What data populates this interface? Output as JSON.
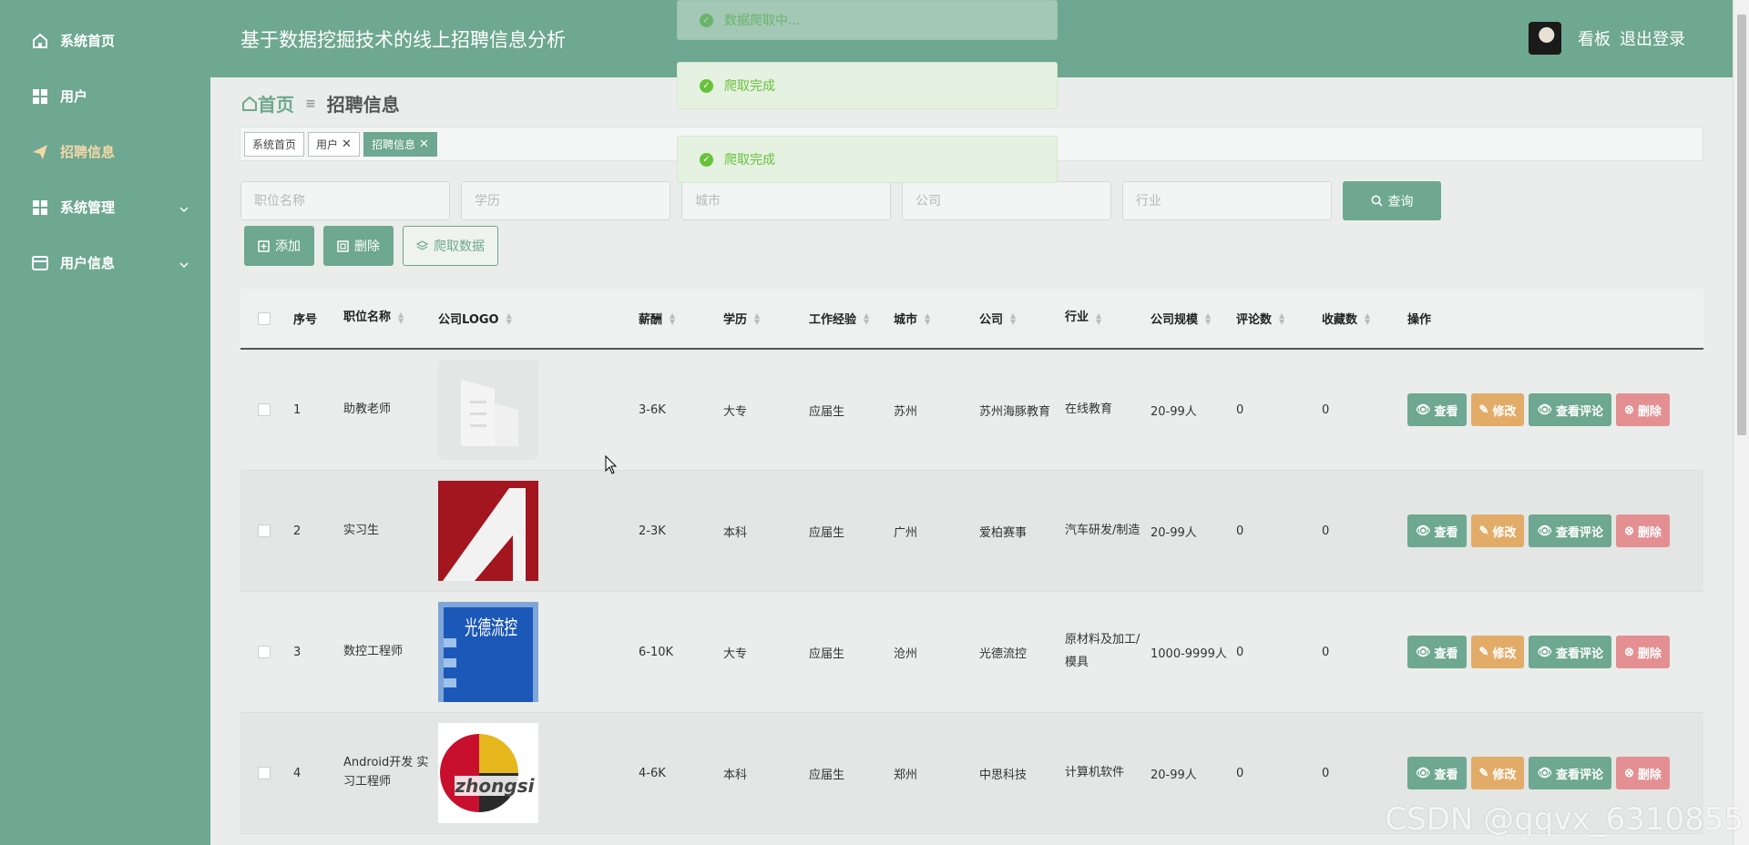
{
  "sidebar": {
    "items": [
      {
        "label": "系统首页",
        "icon": "home-icon"
      },
      {
        "label": "用户",
        "icon": "grid-icon"
      },
      {
        "label": "招聘信息",
        "icon": "paper-plane-icon"
      },
      {
        "label": "系统管理",
        "icon": "grid-icon"
      },
      {
        "label": "用户信息",
        "icon": "card-icon"
      }
    ]
  },
  "header": {
    "title": "基于数据挖掘技术的线上招聘信息分析",
    "board": "看板",
    "logout": "退出登录"
  },
  "breadcrumb": {
    "home": "首页",
    "current": "招聘信息"
  },
  "tags": [
    {
      "label": "系统首页"
    },
    {
      "label": "用户"
    },
    {
      "label": "招聘信息"
    }
  ],
  "filters": {
    "placeholders": [
      "职位名称",
      "学历",
      "城市",
      "公司",
      "行业"
    ],
    "query": "查询"
  },
  "actions": {
    "add": "添加",
    "delete": "删除",
    "crawl": "爬取数据"
  },
  "table": {
    "headers": [
      "序号",
      "职位名称",
      "公司LOGO",
      "薪酬",
      "学历",
      "工作经验",
      "城市",
      "公司",
      "行业",
      "公司规模",
      "评论数",
      "收藏数",
      "操作"
    ],
    "ops": {
      "view": "查看",
      "edit": "修改",
      "comments": "查看评论",
      "delete": "删除"
    },
    "rows": [
      {
        "idx": "1",
        "name": "助教老师",
        "salary": "3-6K",
        "edu": "大专",
        "exp": "应届生",
        "city": "苏州",
        "company": "苏州海豚教育",
        "industry": "在线教育",
        "size": "20-99人",
        "comments": "0",
        "favs": "0",
        "logo": "building"
      },
      {
        "idx": "2",
        "name": "实习生",
        "salary": "2-3K",
        "edu": "本科",
        "exp": "应届生",
        "city": "广州",
        "company": "爱柏赛事",
        "industry": "汽车研发/制造",
        "size": "20-99人",
        "comments": "0",
        "favs": "0",
        "logo": "red-a"
      },
      {
        "idx": "3",
        "name": "数控工程师",
        "salary": "6-10K",
        "edu": "大专",
        "exp": "应届生",
        "city": "沧州",
        "company": "光德流控",
        "industry": "原材料及加工/模具",
        "size": "1000-9999人",
        "comments": "0",
        "favs": "0",
        "logo": "blue-building"
      },
      {
        "idx": "4",
        "name": "Android开发 实习工程师",
        "salary": "4-6K",
        "edu": "本科",
        "exp": "应届生",
        "city": "郑州",
        "company": "中思科技",
        "industry": "计算机软件",
        "size": "20-99人",
        "comments": "0",
        "favs": "0",
        "logo": "zhongsi"
      }
    ]
  },
  "toasts": [
    {
      "text": "数据爬取中..."
    },
    {
      "text": "爬取完成"
    },
    {
      "text": "爬取完成"
    }
  ],
  "logo_text": {
    "zhongsi": "zhongsi",
    "guangde": "光德流控"
  },
  "watermark": "CSDN @qqvx_6310855",
  "colors": {
    "primary": "#6ea792",
    "edit": "#e2ac68",
    "danger": "#e48f92",
    "success": "#67c23a",
    "active_menu": "#f3d7a6"
  }
}
